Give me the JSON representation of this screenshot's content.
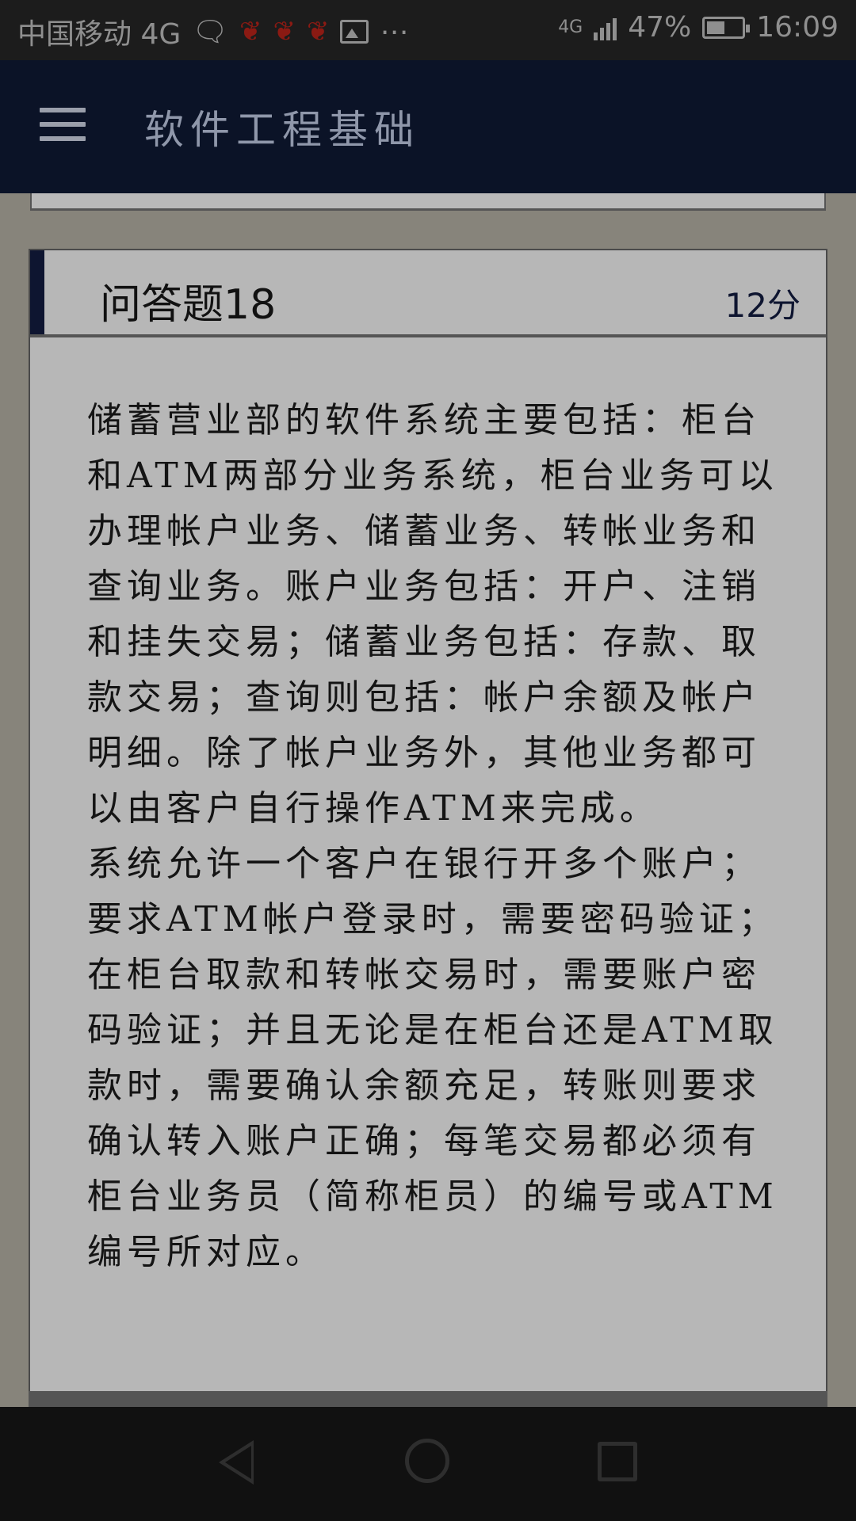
{
  "status_bar": {
    "carrier": "中国移动 4G",
    "network": "4G",
    "battery": "47%",
    "time": "16:09",
    "icons": [
      "chat-bubble-icon",
      "app-notification-icon",
      "app-notification-icon",
      "app-notification-icon",
      "image-icon",
      "more-dots-icon",
      "signal-icon",
      "battery-icon"
    ]
  },
  "header": {
    "title": "软件工程基础",
    "menu_icon": "hamburger-menu-icon"
  },
  "question": {
    "title": "问答题18",
    "score": "12分",
    "paragraphs": [
      "储蓄营业部的软件系统主要包括：柜台和ATM两部分业务系统，柜台业务可以办理帐户业务、储蓄业务、转帐业务和查询业务。账户业务包括：开户、注销和挂失交易；储蓄业务包括：存款、取款交易；查询则包括：帐户余额及帐户明细。除了帐户业务外，其他业务都可以由客户自行操作ATM来完成。",
      "系统允许一个客户在银行开多个账户；要求ATM帐户登录时，需要密码验证；在柜台取款和转帐交易时，需要账户密码验证；并且无论是在柜台还是ATM取款时，需要确认余额充足，转账则要求确认转入账户正确；每笔交易都必须有柜台业务员（简称柜员）的编号或ATM编号所对应。"
    ]
  },
  "nav_bar": {
    "buttons": [
      "back-icon",
      "home-icon",
      "recent-apps-icon"
    ]
  },
  "colors": {
    "header_bg": "#0b1327",
    "card_bg": "#b7b7b7",
    "page_bg": "#87847b",
    "accent": "#0e1530"
  }
}
